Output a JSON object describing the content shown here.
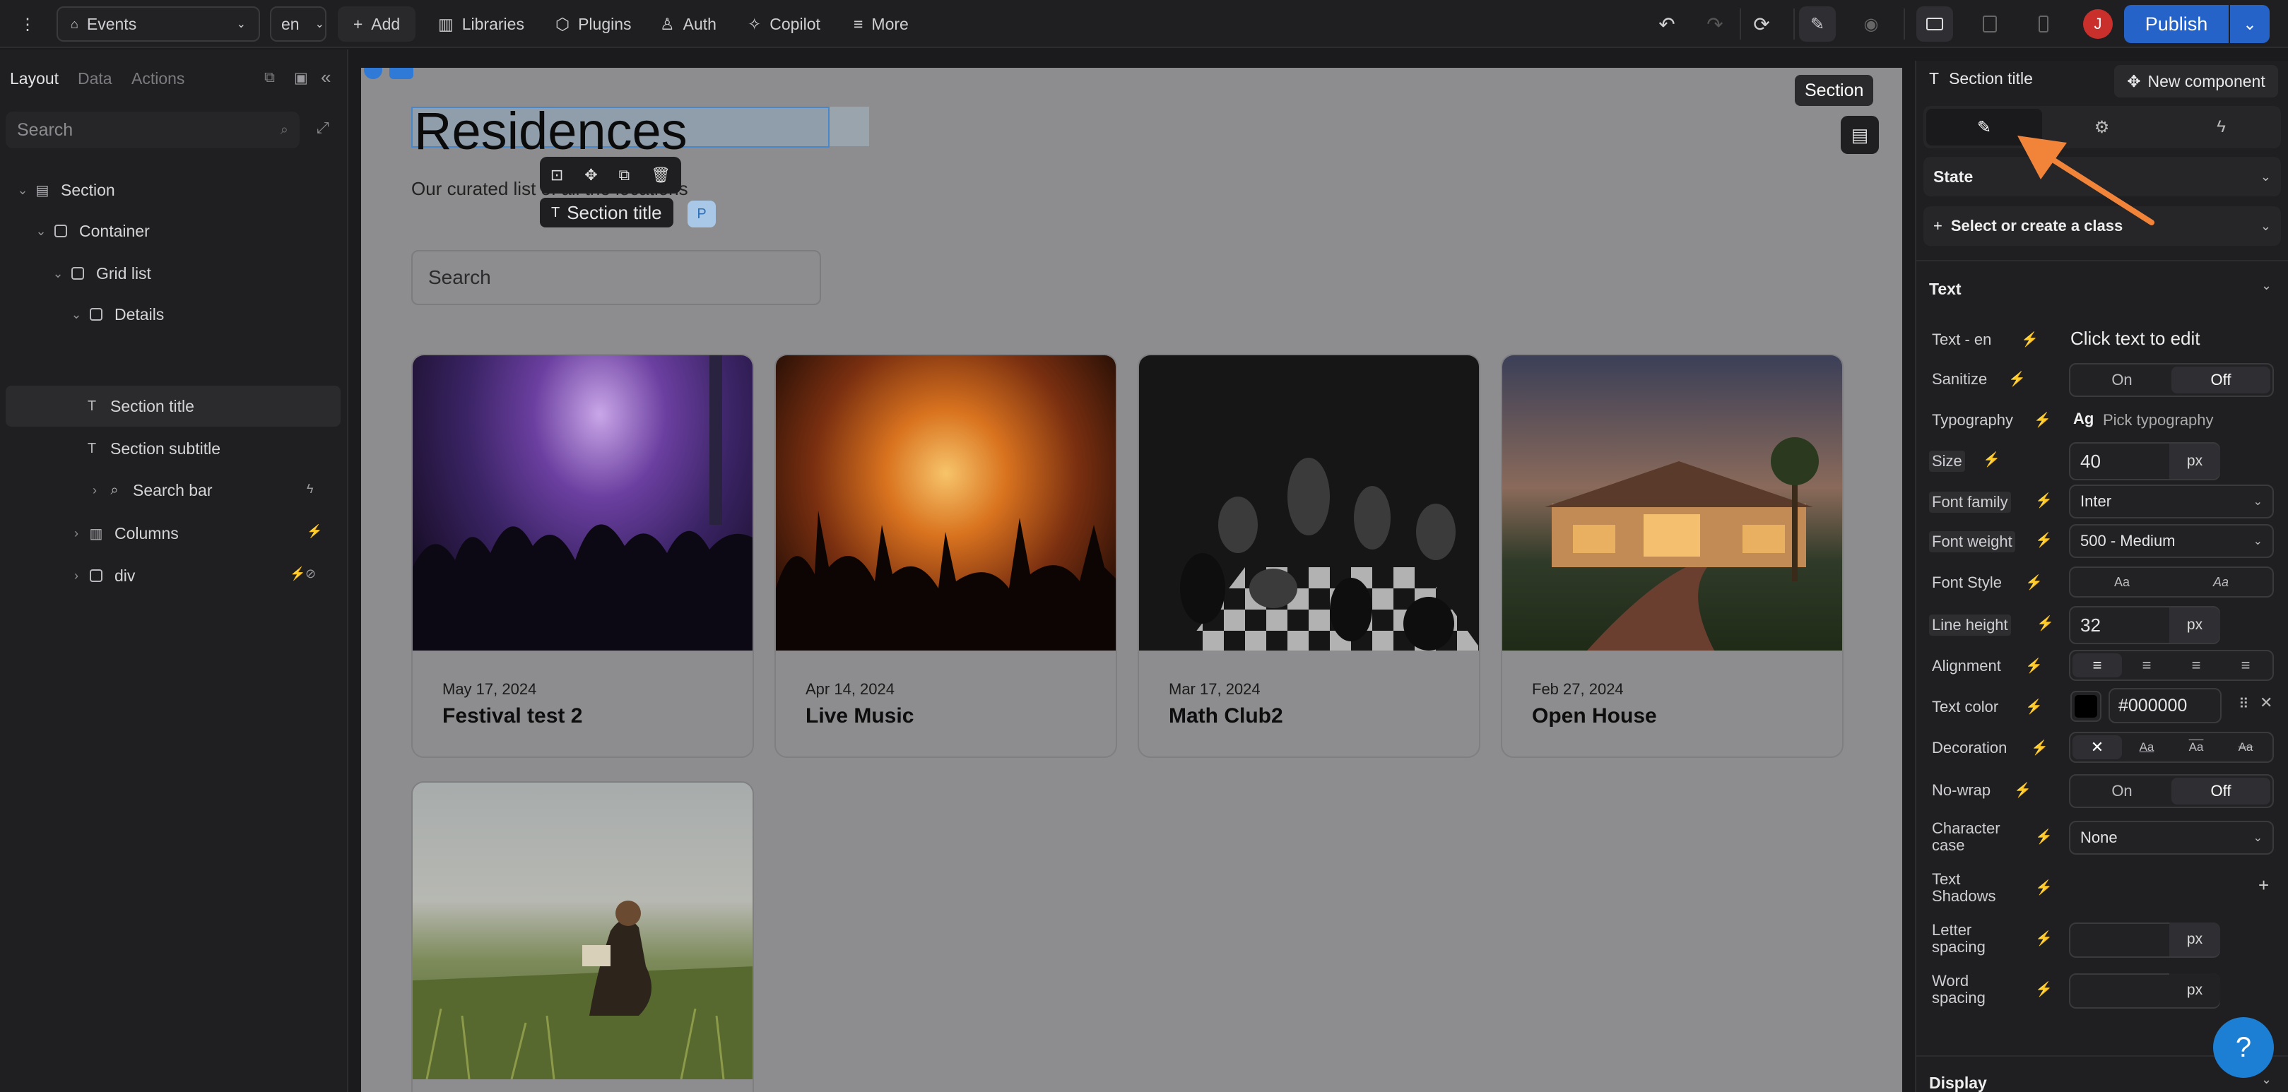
{
  "topbar": {
    "page_select": "Events",
    "lang_select": "en",
    "add": "Add",
    "libraries": "Libraries",
    "plugins": "Plugins",
    "auth": "Auth",
    "copilot": "Copilot",
    "more": "More",
    "publish": "Publish",
    "avatar_initial": "J"
  },
  "left": {
    "tabs": [
      "Layout",
      "Data",
      "Actions"
    ],
    "search_placeholder": "Search",
    "tree": [
      {
        "label": "Section"
      },
      {
        "label": "Container"
      },
      {
        "label": "Grid list"
      },
      {
        "label": "Details"
      },
      {
        "label": "Section title"
      },
      {
        "label": "Section subtitle"
      },
      {
        "label": "Search bar"
      },
      {
        "label": "Columns"
      },
      {
        "label": "div"
      }
    ]
  },
  "canvas": {
    "section_badge": "Section",
    "title": "Residences",
    "subtitle": "Our curated list of all the locations",
    "search_placeholder": "Search",
    "selected_tag": "Section title",
    "p_badge": "P",
    "cards": [
      {
        "date": "May 17, 2024",
        "title": "Festival test 2"
      },
      {
        "date": "Apr 14, 2024",
        "title": "Live Music"
      },
      {
        "date": "Mar 17, 2024",
        "title": "Math Club2"
      },
      {
        "date": "Feb 27, 2024",
        "title": "Open House"
      }
    ]
  },
  "right": {
    "header": "Section title",
    "new_component": "New component",
    "state": "State",
    "class_select": "Select or create a class",
    "text_section": "Text",
    "labels": {
      "text_en": "Text - en",
      "sanitize": "Sanitize",
      "typography": "Typography",
      "size": "Size",
      "font_family": "Font family",
      "font_weight": "Font weight",
      "font_style": "Font Style",
      "line_height": "Line height",
      "alignment": "Alignment",
      "text_color": "Text color",
      "decoration": "Decoration",
      "nowrap": "No-wrap",
      "char_case_1": "Character",
      "char_case_2": "case",
      "shadows_1": "Text",
      "shadows_2": "Shadows",
      "letter_1": "Letter",
      "letter_2": "spacing",
      "word_1": "Word",
      "word_2": "spacing",
      "display": "Display"
    },
    "values": {
      "text_en": "Click text to edit",
      "on": "On",
      "off": "Off",
      "pick_typography": "Pick typography",
      "ag": "Ag",
      "size": "40",
      "unit": "px",
      "font_family": "Inter",
      "font_weight": "500 - Medium",
      "aa": "Aa",
      "line_height": "32",
      "text_color": "#000000",
      "char_case": "None"
    }
  },
  "colors": {
    "accent": "#2f7ad6",
    "publish": "#2563c9",
    "arrow": "#f2843a",
    "avatar": "#c9302c"
  }
}
